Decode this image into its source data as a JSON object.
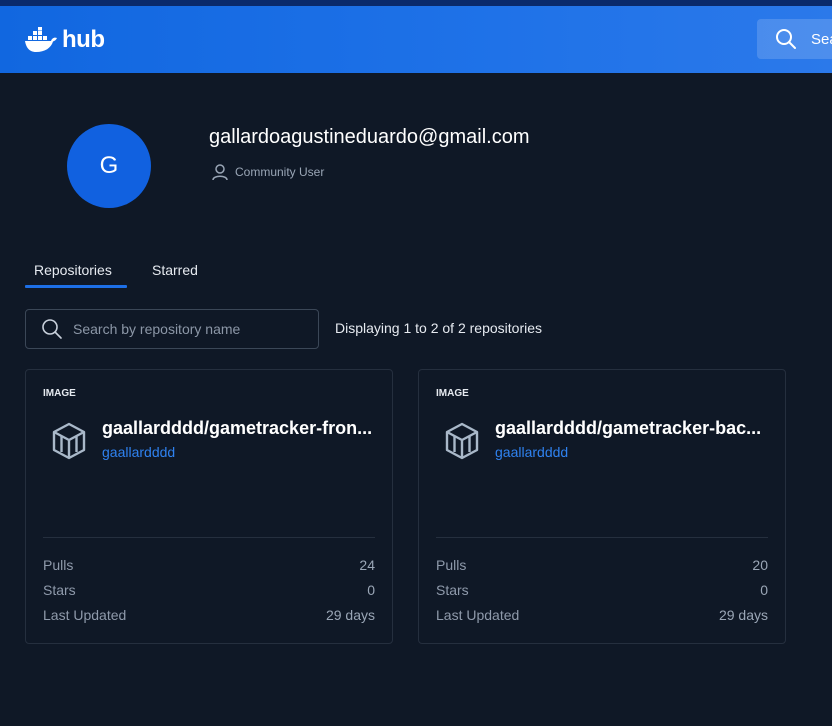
{
  "header": {
    "logo_text": "hub",
    "search_text": "Sea"
  },
  "profile": {
    "avatar_letter": "G",
    "email": "gallardoagustineduardo@gmail.com",
    "user_type": "Community User"
  },
  "tabs": [
    {
      "label": "Repositories",
      "active": true
    },
    {
      "label": "Starred",
      "active": false
    }
  ],
  "search": {
    "placeholder": "Search by repository name"
  },
  "displaying": "Displaying 1 to 2 of 2 repositories",
  "repos": [
    {
      "type": "IMAGE",
      "name": "gaallardddd/gametracker-fron...",
      "owner": "gaallardddd",
      "stats": [
        {
          "label": "Pulls",
          "value": "24"
        },
        {
          "label": "Stars",
          "value": "0"
        },
        {
          "label": "Last Updated",
          "value": "29 days"
        }
      ]
    },
    {
      "type": "IMAGE",
      "name": "gaallardddd/gametracker-bac...",
      "owner": "gaallardddd",
      "stats": [
        {
          "label": "Pulls",
          "value": "20"
        },
        {
          "label": "Stars",
          "value": "0"
        },
        {
          "label": "Last Updated",
          "value": "29 days"
        }
      ]
    }
  ],
  "colors": {
    "header_blue": "#1167e0",
    "background": "#0f1826",
    "accent": "#1d6fe6",
    "link": "#2f82f0"
  }
}
